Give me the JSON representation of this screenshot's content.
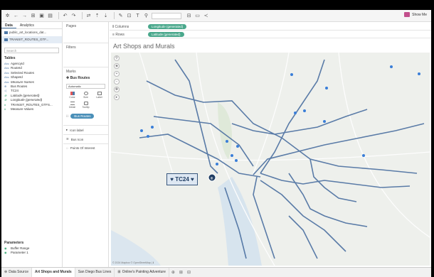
{
  "toolbar": {
    "show_me": "Show Me"
  },
  "data_pane": {
    "tabs": [
      "Data",
      "Analytics"
    ],
    "sources": [
      "public_art_locations_dat...",
      "TRANSIT_ROUTES_GTF..."
    ],
    "search_placeholder": "Search",
    "tables_heading": "Tables",
    "fields": [
      {
        "type": "Abc",
        "name": "AgencyId",
        "italic": false,
        "measure": false
      },
      {
        "type": "Abc",
        "name": "RouteId",
        "italic": false,
        "measure": false
      },
      {
        "type": "Abc",
        "name": "Selected Routes",
        "italic": false,
        "measure": false
      },
      {
        "type": "Abc",
        "name": "ShapeId",
        "italic": false,
        "measure": false
      },
      {
        "type": "Abc",
        "name": "Measure Names",
        "italic": true,
        "measure": false
      },
      {
        "type": "⊕",
        "name": "Bus Routes",
        "italic": false,
        "measure": false
      },
      {
        "type": "◁",
        "name": "TC24",
        "italic": false,
        "measure": false
      },
      {
        "type": "⊕",
        "name": "Latitude (generated)",
        "italic": true,
        "measure": true
      },
      {
        "type": "⊕",
        "name": "Longitude (generated)",
        "italic": true,
        "measure": true
      },
      {
        "type": "#",
        "name": "TRANSIT_ROUTES_GTFS...",
        "italic": false,
        "measure": true
      },
      {
        "type": "#",
        "name": "Measure Values",
        "italic": false,
        "measure": true
      }
    ],
    "parameters_heading": "Parameters",
    "parameters": [
      "Buffer Range",
      "Parameter 1"
    ]
  },
  "cards": {
    "pages": "Pages",
    "filters": "Filters",
    "marks": "Marks",
    "marks_layer": "Bus Routes",
    "mark_type": "Automatic",
    "mark_buttons": [
      "Color",
      "Size",
      "Label",
      "Detail",
      "Tooltip"
    ],
    "detail_pill": "Bus Routes",
    "layers": [
      "Icon label",
      "Bus Icon",
      "Points Of Interest"
    ]
  },
  "shelves": {
    "columns_label": "Columns",
    "columns_pill": "Longitude (generated)",
    "rows_label": "Rows",
    "rows_pill": "Latitude (generated)"
  },
  "viz": {
    "title": "Art Shops and Murals",
    "tooltip_label": "TC24",
    "attribution": "© 2024 Mapbox © OpenStreetMap | ℹ",
    "route_color": "#4a6fa0",
    "point_color": "#3a7ed8"
  },
  "sheet_tabs": {
    "data_source": "Data Source",
    "tabs": [
      "Art Shops and Murals",
      "San Diego Bus Lines",
      "Online's Painting Adventure"
    ],
    "active": "Art Shops and Murals"
  }
}
